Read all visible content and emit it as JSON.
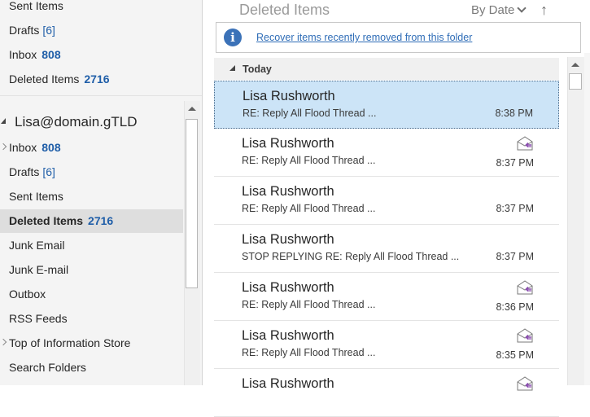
{
  "nav": {
    "favorites": [
      {
        "label": "Sent Items",
        "count": "",
        "count_style": ""
      },
      {
        "label": "Drafts",
        "count": "6",
        "count_style": "bracket"
      },
      {
        "label": "Inbox",
        "count": "808",
        "count_style": "bold"
      },
      {
        "label": "Deleted Items",
        "count": "2716",
        "count_style": "bold"
      }
    ],
    "account": "Lisa@domain.gTLD",
    "folders": [
      {
        "label": "Inbox",
        "count": "808",
        "count_style": "bold",
        "expandable": true
      },
      {
        "label": "Drafts",
        "count": "6",
        "count_style": "bracket"
      },
      {
        "label": "Sent Items",
        "count": ""
      },
      {
        "label": "Deleted Items",
        "count": "2716",
        "count_style": "bold",
        "selected": true
      },
      {
        "label": "Junk Email",
        "count": ""
      },
      {
        "label": "Junk E-mail",
        "count": ""
      },
      {
        "label": "Outbox",
        "count": ""
      },
      {
        "label": "RSS Feeds",
        "count": ""
      },
      {
        "label": "Top of Information Store",
        "count": "",
        "expandable": true
      },
      {
        "label": "Search Folders",
        "count": ""
      }
    ]
  },
  "list": {
    "folder_title": "Deleted Items",
    "sort_label": "By Date",
    "sort_arrow": "↑",
    "info_text": "Recover items recently removed from this folder",
    "group_label": "Today",
    "messages": [
      {
        "sender": "Lisa Rushworth",
        "subject": "RE: Reply All Flood Thread ...",
        "time": "8:38 PM",
        "icon": "",
        "selected": true
      },
      {
        "sender": "Lisa Rushworth",
        "subject": "RE: Reply All Flood Thread ...",
        "time": "8:37 PM",
        "icon": "reply-all-envelope-icon"
      },
      {
        "sender": "Lisa Rushworth",
        "subject": "RE: Reply All Flood Thread ...",
        "time": "8:37 PM",
        "icon": ""
      },
      {
        "sender": "Lisa Rushworth",
        "subject": "STOP REPLYING RE: Reply All Flood Thread ...",
        "time": "8:37 PM",
        "icon": ""
      },
      {
        "sender": "Lisa Rushworth",
        "subject": "RE: Reply All Flood Thread ...",
        "time": "8:36 PM",
        "icon": "reply-all-envelope-icon"
      },
      {
        "sender": "Lisa Rushworth",
        "subject": "RE: Reply All Flood Thread ...",
        "time": "8:35 PM",
        "icon": "reply-all-envelope-icon"
      },
      {
        "sender": "Lisa Rushworth",
        "subject": "",
        "time": "",
        "icon": "reply-all-envelope-icon"
      }
    ]
  },
  "colors": {
    "count_blue": "#1f5ea8",
    "selection_blue": "#cce4f7",
    "info_blue": "#3b72b8",
    "reply_purple": "#8a4bb0"
  }
}
